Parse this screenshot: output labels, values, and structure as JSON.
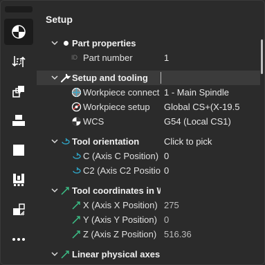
{
  "panel": {
    "title": "Setup"
  },
  "sidebar": {
    "items": [
      {
        "name": "setup-icon"
      },
      {
        "name": "flip-icon"
      },
      {
        "name": "copy-icon"
      },
      {
        "name": "stack-icon"
      },
      {
        "name": "stock-icon"
      },
      {
        "name": "fixture-icon"
      },
      {
        "name": "pattern-icon"
      },
      {
        "name": "more-icon"
      }
    ]
  },
  "tree": {
    "part_properties": {
      "label": "Part properties"
    },
    "part_number": {
      "label": "Part number",
      "value": "1",
      "prefix": "ID"
    },
    "setup_tooling": {
      "label": "Setup and tooling"
    },
    "workpiece_connect": {
      "label": "Workpiece connect",
      "value": "1 - Main Spindle"
    },
    "workpiece_setup": {
      "label": "Workpiece setup",
      "value": "Global CS+(X-19.5"
    },
    "wcs": {
      "label": "WCS",
      "value": "G54 (Local CS1)"
    },
    "tool_orientation": {
      "label": "Tool orientation",
      "value": "Click to pick"
    },
    "c_axis": {
      "label": "C (Axis C Position)",
      "value": "0"
    },
    "c2_axis": {
      "label": "C2 (Axis C2 Position",
      "value": "0"
    },
    "tool_coords": {
      "label": "Tool coordinates in WC"
    },
    "x_axis": {
      "label": "X (Axis X Position)",
      "value": "275"
    },
    "y_axis": {
      "label": "Y (Axis Y Position)",
      "value": "0"
    },
    "z_axis": {
      "label": "Z (Axis Z Position)",
      "value": "516.36"
    },
    "linear_axes": {
      "label": "Linear physical axes"
    }
  }
}
